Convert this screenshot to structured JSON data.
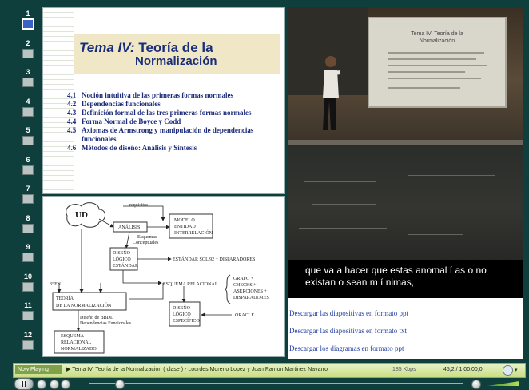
{
  "rail": {
    "items": [
      "1",
      "2",
      "3",
      "4",
      "5",
      "6",
      "7",
      "8",
      "9",
      "10",
      "11",
      "12"
    ],
    "active": "1"
  },
  "slide1": {
    "title_prefix": "Tema IV:",
    "title_rest": "Teoría de la",
    "title_line2": "Normalización",
    "toc": [
      {
        "n": "4.1",
        "t": "Noción intuitiva de las primeras formas normales"
      },
      {
        "n": "4.2",
        "t": "Dependencias funcionales"
      },
      {
        "n": "4.3",
        "t": "Definición formal de las tres primeras formas normales"
      },
      {
        "n": "4.4",
        "t": "Forma Normal de Boyce y Codd"
      },
      {
        "n": "4.5",
        "t": "Axiomas de Armstrong y manipulación de dependencias funcionales"
      },
      {
        "n": "4.6",
        "t": "Métodos de diseño: Análisis y Síntesis"
      }
    ]
  },
  "diagram": {
    "ud": "UD",
    "requisitos": "requisitos",
    "analisis": "ANÁLISIS",
    "modelo": [
      "MODELO",
      "ENTIDAD",
      "INTERRELACIÓN"
    ],
    "esquemas": [
      "Esquemas",
      "Conceptuales"
    ],
    "diseno_logico": [
      "DISEÑO",
      "LÓGICO",
      "ESTÁNDAR"
    ],
    "estandar": "ESTÁNDAR SQL 92 + DISPARADORES",
    "fn": "3ª FN",
    "esquema_rel": "ESQUEMA RELACIONAL",
    "grafo": [
      "GRAFO +",
      "CHECKS +",
      "ASERCIONES +",
      "DISPARADORES"
    ],
    "teoria": [
      "TEORÍA",
      "DE LA NORMALIZACIÓN"
    ],
    "diseno_bbdd": [
      "Diseño de BBDD",
      "Dependencias Funcionales"
    ],
    "diseno_esp": [
      "DISEÑO",
      "LÓGICO",
      "ESPECÍFICO"
    ],
    "oracle": "ORACLE",
    "esquema_norm": [
      "ESQUEMA",
      "RELACIONAL",
      "NORMALIZADO"
    ]
  },
  "video": {
    "screen_title": "Tema IV: Teoría de la",
    "screen_title2": "Normalización",
    "subtitle_line1": "que va a hacer que estas anomal í as o no",
    "subtitle_line2": "existan o sean m í nimas,"
  },
  "links": [
    "Descargar las diapositivas en formato ppt",
    "Descargar las diapositivas en formato txt",
    "Descargar los diagramas en formato ppt"
  ],
  "player": {
    "now_playing": "Now Playing",
    "title": "Tema IV: Teoría de la Normalizacion ( clase ) - Lourdes Moreno Lopez y Juan Ramon Martinez Navarro",
    "speed": "185 Kbps",
    "time": "45,2 / 1:00:00,0",
    "progress": 0.08
  }
}
